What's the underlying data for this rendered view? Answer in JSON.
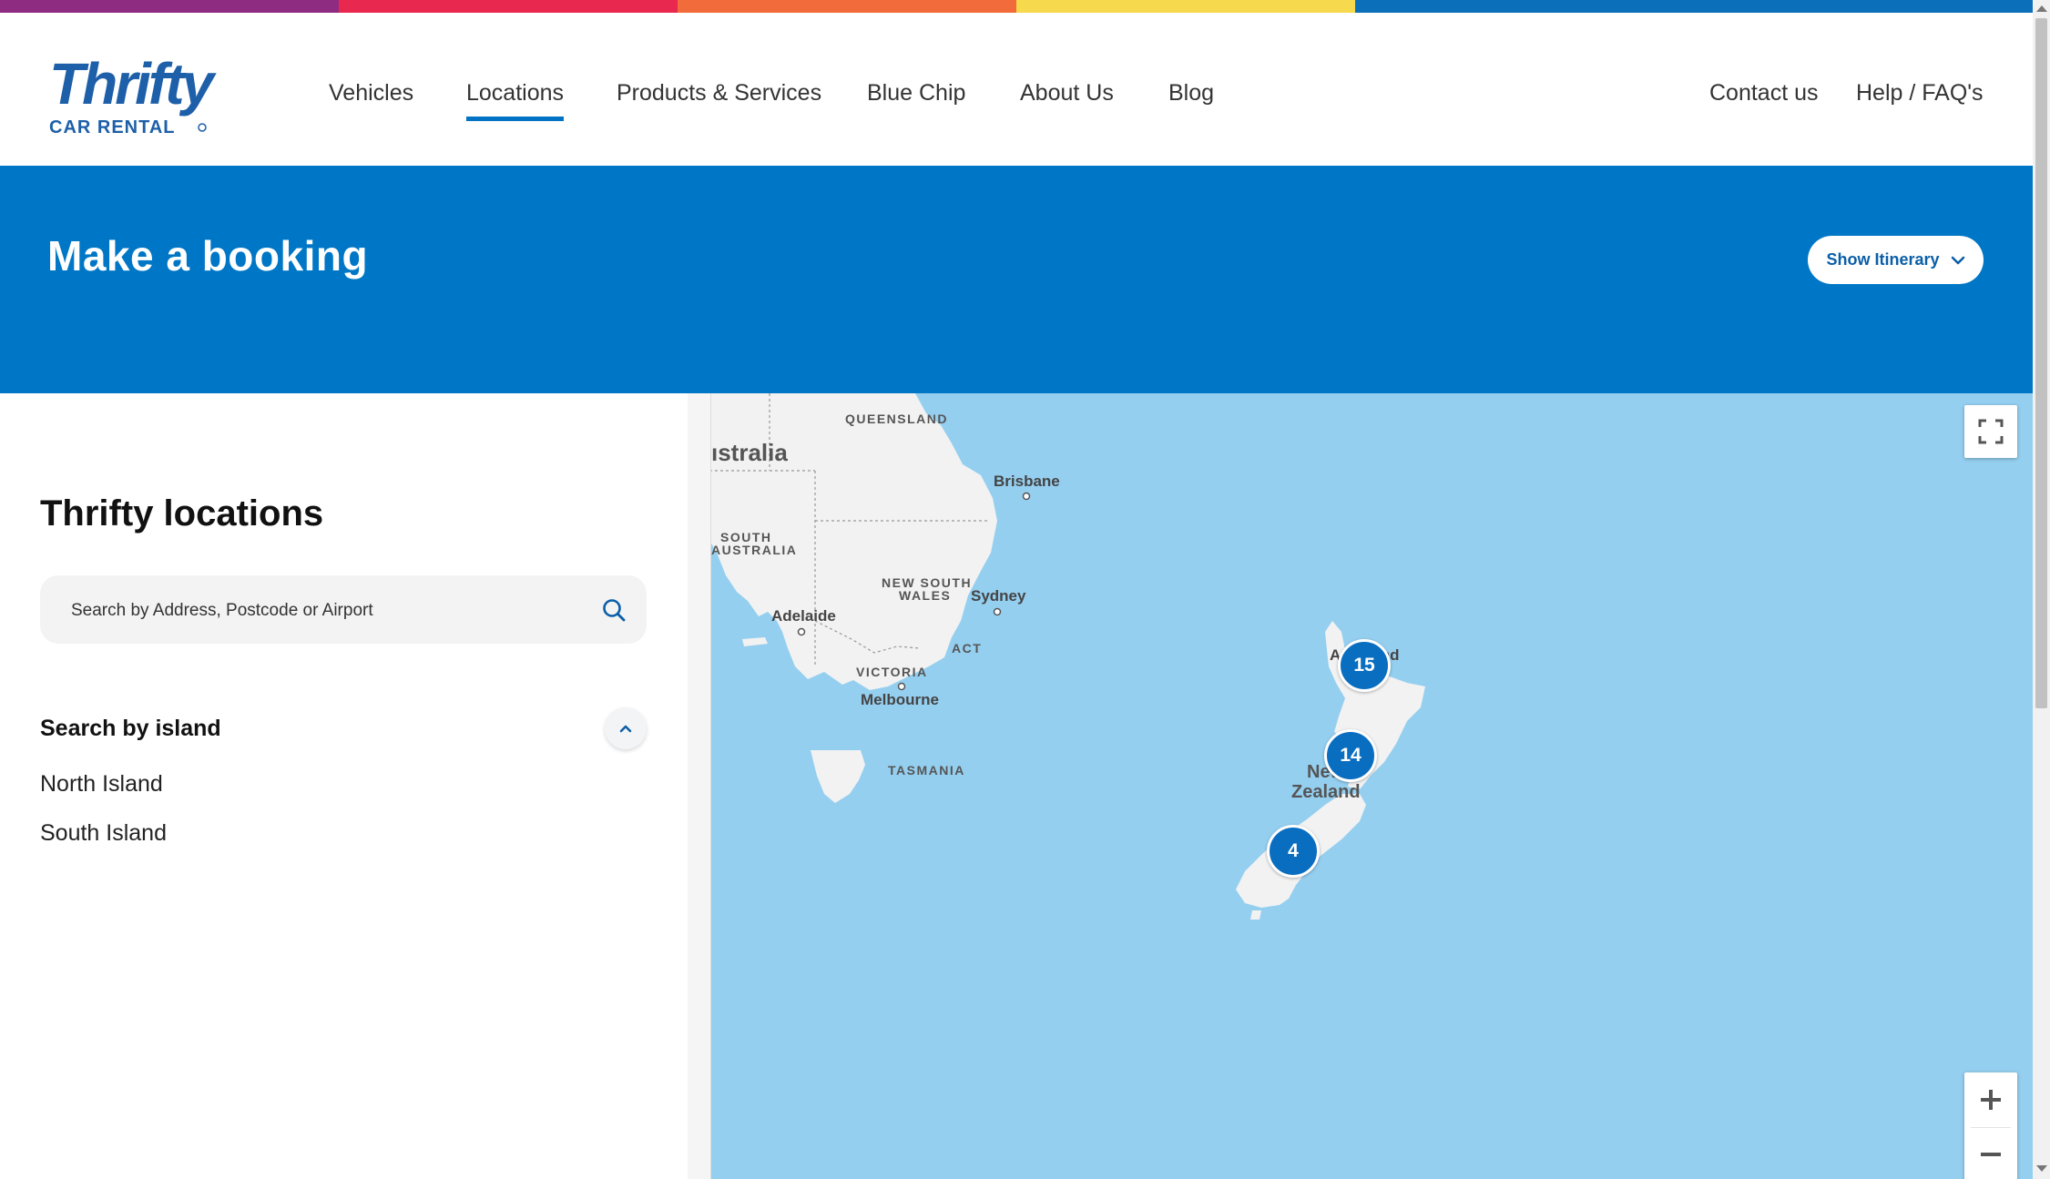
{
  "topbar": {
    "colors": [
      "#8e2c82",
      "#e8284e",
      "#f26b3a",
      "#f6d94c",
      "#0c6fb9",
      "#0c6fb9"
    ]
  },
  "logo": {
    "word": "Thrifty",
    "tagline": "CAR RENTAL",
    "color": "#1d5fa8"
  },
  "nav": {
    "items": [
      {
        "label": "Vehicles"
      },
      {
        "label": "Locations",
        "active": true
      },
      {
        "label": "Products & Services"
      },
      {
        "label": "Blue Chip"
      },
      {
        "label": "About Us"
      },
      {
        "label": "Blog"
      }
    ],
    "right": [
      {
        "label": "Contact us"
      },
      {
        "label": "Help / FAQ's"
      }
    ]
  },
  "banner": {
    "title": "Make a booking",
    "itinerary_button": "Show Itinerary",
    "color": "#0077c6"
  },
  "sidebar": {
    "title": "Thrifty locations",
    "search_placeholder": "Search by Address, Postcode or Airport",
    "island_heading": "Search by island",
    "islands": [
      "North Island",
      "South Island"
    ]
  },
  "map": {
    "region_labels": [
      "QUEENSLAND",
      "SOUTH",
      "AUSTRALIA",
      "NEW SOUTH",
      "WALES",
      "VICTORIA",
      "ACT",
      "TASMANIA"
    ],
    "cities": [
      "Brisbane",
      "Sydney",
      "Adelaide",
      "Melbourne",
      "Auckland"
    ],
    "country_labels": [
      "ıstralia",
      "New",
      "Zealand"
    ],
    "clusters": [
      {
        "count": "15"
      },
      {
        "count": "14"
      },
      {
        "count": "4"
      }
    ],
    "water_color": "#95cff0",
    "land_color": "#f2f2f2"
  }
}
